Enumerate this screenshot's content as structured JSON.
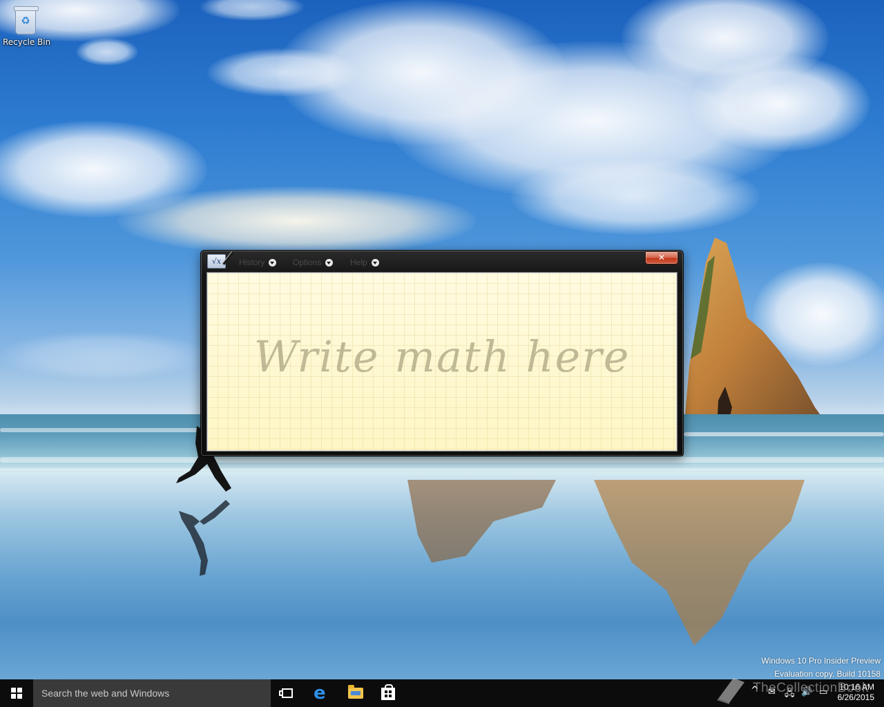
{
  "desktop": {
    "icons": [
      {
        "label": "Recycle Bin",
        "icon": "recycle-bin-icon"
      }
    ],
    "watermark": {
      "line1": "Windows 10 Pro Insider Preview",
      "line2": "Evaluation copy. Build 10158"
    }
  },
  "math_input_panel": {
    "menus": [
      {
        "label": "History"
      },
      {
        "label": "Options"
      },
      {
        "label": "Help"
      }
    ],
    "close_glyph": "✕",
    "app_icon_glyph": "√x",
    "placeholder": "Write math here"
  },
  "taskbar": {
    "search_placeholder": "Search the web and Windows",
    "pinned": [
      "task-view-icon",
      "edge-icon",
      "file-explorer-icon",
      "store-icon"
    ],
    "tray": {
      "show_hidden_glyph": "^",
      "time": "10:16 AM",
      "date": "6/26/2015"
    },
    "brand_text": "TheCollectionBook"
  },
  "colors": {
    "taskbar_bg": "#0c0c0c",
    "search_bg": "#3a3a3a",
    "writing_area_bg": "#fef9d2",
    "close_button": "#c2391c",
    "edge_blue": "#2e8fe5"
  }
}
